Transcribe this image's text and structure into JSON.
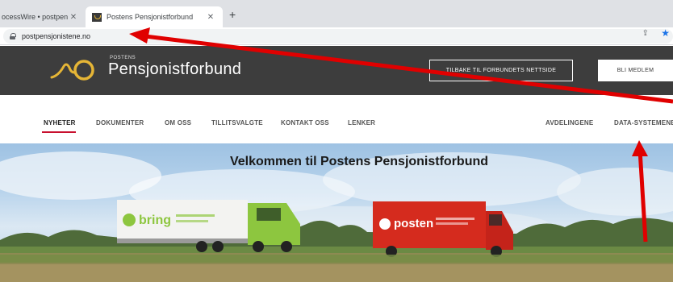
{
  "browser": {
    "tabs": [
      {
        "title": "ocessWire • postpensjo",
        "close": "✕"
      },
      {
        "title": "Postens Pensjonistforbund",
        "close": "✕"
      }
    ],
    "new_tab": "+",
    "url": "postpensjonistene.no"
  },
  "header": {
    "brand_small": "POSTENS",
    "brand_name": "Pensjonistforbund",
    "back_button": "TILBAKE TIL FORBUNDETS NETTSIDE",
    "join_button": "BLI MEDLEM"
  },
  "nav": {
    "items": [
      "NYHETER",
      "DOKUMENTER",
      "OM OSS",
      "TILLITSVALGTE",
      "KONTAKT OSS",
      "LENKER"
    ],
    "right_items": [
      "AVDELINGENE",
      "DATA-SYSTEMENE"
    ],
    "active": "NYHETER"
  },
  "hero": {
    "title": "Velkommen til Postens Pensjonistforbund",
    "truck_left_brand": "bring",
    "truck_right_brand": "posten"
  },
  "colors": {
    "header_bg": "#3d3d3d",
    "accent": "#c8102e",
    "logo_gold": "#e5b536",
    "bring_green": "#8dc63f",
    "posten_red": "#d52b1e",
    "annotation_arrow": "#e00000"
  }
}
